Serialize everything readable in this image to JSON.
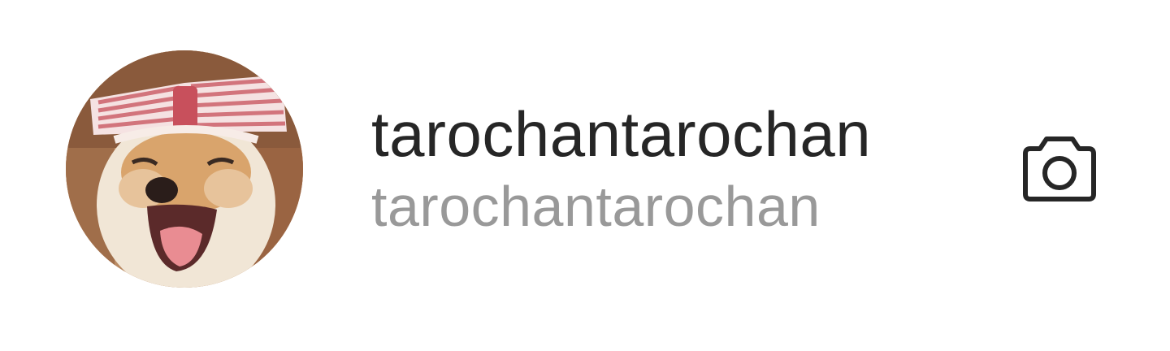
{
  "profile": {
    "display_name": "tarochantarochan",
    "username": "tarochantarochan",
    "avatar_icon": "shiba-dog-with-bow-photo"
  },
  "actions": {
    "camera_icon": "camera-icon"
  },
  "colors": {
    "background": "#ffffff",
    "primary_text": "#262626",
    "secondary_text": "#999999",
    "icon": "#262626"
  }
}
